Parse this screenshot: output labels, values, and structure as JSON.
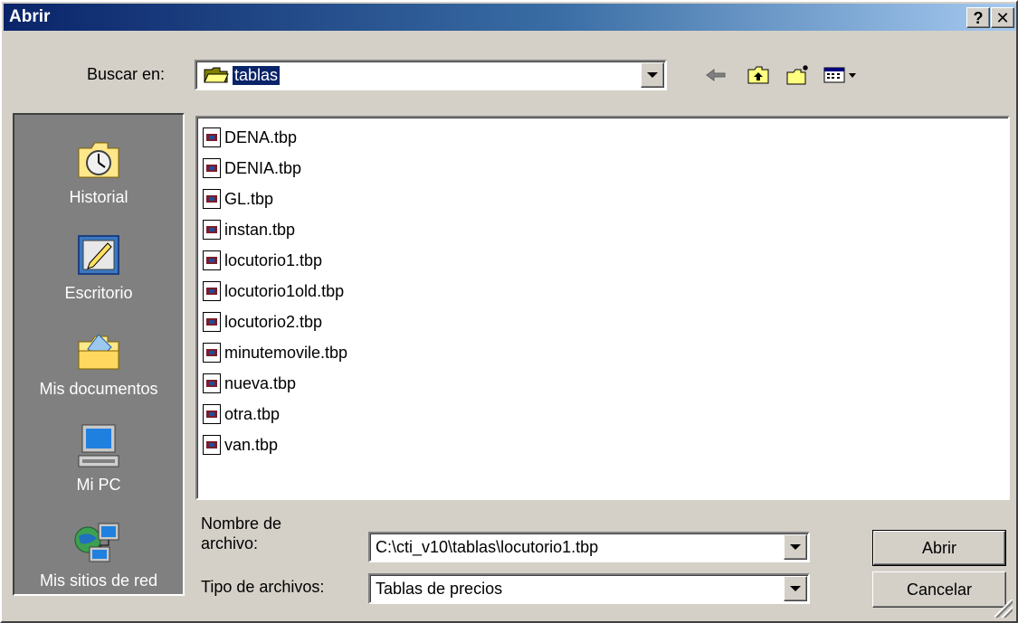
{
  "window": {
    "title": "Abrir",
    "help_label": "?",
    "close_label": "✕"
  },
  "lookin": {
    "label": "Buscar en:",
    "value": "tablas"
  },
  "toolbar": {
    "icons": [
      "back-arrow-icon",
      "up-one-level-icon",
      "new-folder-icon",
      "view-menu-icon"
    ]
  },
  "places": [
    {
      "label": "Historial",
      "icon": "history-icon"
    },
    {
      "label": "Escritorio",
      "icon": "desktop-icon"
    },
    {
      "label": "Mis documentos",
      "icon": "my-documents-icon"
    },
    {
      "label": "Mi PC",
      "icon": "my-computer-icon"
    },
    {
      "label": "Mis sitios de red",
      "icon": "network-places-icon"
    }
  ],
  "files": [
    "DENA.tbp",
    "DENIA.tbp",
    "GL.tbp",
    "instan.tbp",
    "locutorio1.tbp",
    "locutorio1old.tbp",
    "locutorio2.tbp",
    "minutemovile.tbp",
    "nueva.tbp",
    "otra.tbp",
    "van.tbp"
  ],
  "filename": {
    "label_line1": "Nombre de",
    "label_line2": "archivo:",
    "value": "C:\\cti_v10\\tablas\\locutorio1.tbp"
  },
  "filetype": {
    "label": "Tipo de archivos:",
    "value": "Tablas de precios"
  },
  "buttons": {
    "open": "Abrir",
    "cancel": "Cancelar"
  }
}
